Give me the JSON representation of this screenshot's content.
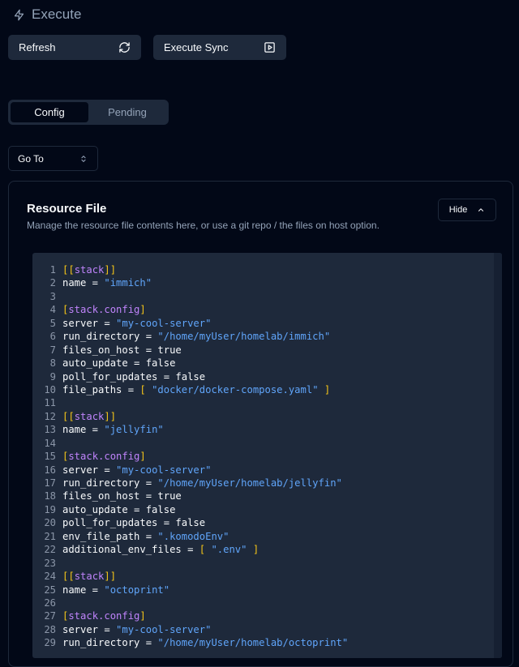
{
  "header": {
    "title": "Execute",
    "icon": "zap-icon"
  },
  "toolbar": {
    "refresh_label": "Refresh",
    "execute_sync_label": "Execute Sync"
  },
  "tabs": [
    {
      "label": "Config",
      "active": true
    },
    {
      "label": "Pending",
      "active": false
    }
  ],
  "goto": {
    "label": "Go To"
  },
  "resource_file": {
    "title": "Resource File",
    "description": "Manage the resource file contents here, or use a git repo / the files on host option.",
    "hide_label": "Hide"
  },
  "colors": {
    "background": "#020817",
    "surface": "#1e293b",
    "muted_text": "#94a3b8",
    "bracket": "#f5c518",
    "section": "#c084fc",
    "string": "#60a5fa"
  },
  "code_lines": [
    "[[stack]]",
    "name = \"immich\"",
    "",
    "[stack.config]",
    "server = \"my-cool-server\"",
    "run_directory = \"/home/myUser/homelab/immich\"",
    "files_on_host = true",
    "auto_update = false",
    "poll_for_updates = false",
    "file_paths = [ \"docker/docker-compose.yaml\" ]",
    "",
    "[[stack]]",
    "name = \"jellyfin\"",
    "",
    "[stack.config]",
    "server = \"my-cool-server\"",
    "run_directory = \"/home/myUser/homelab/jellyfin\"",
    "files_on_host = true",
    "auto_update = false",
    "poll_for_updates = false",
    "env_file_path = \".komodoEnv\"",
    "additional_env_files = [ \".env\" ]",
    "",
    "[[stack]]",
    "name = \"octoprint\"",
    "",
    "[stack.config]",
    "server = \"my-cool-server\"",
    "run_directory = \"/home/myUser/homelab/octoprint\""
  ]
}
